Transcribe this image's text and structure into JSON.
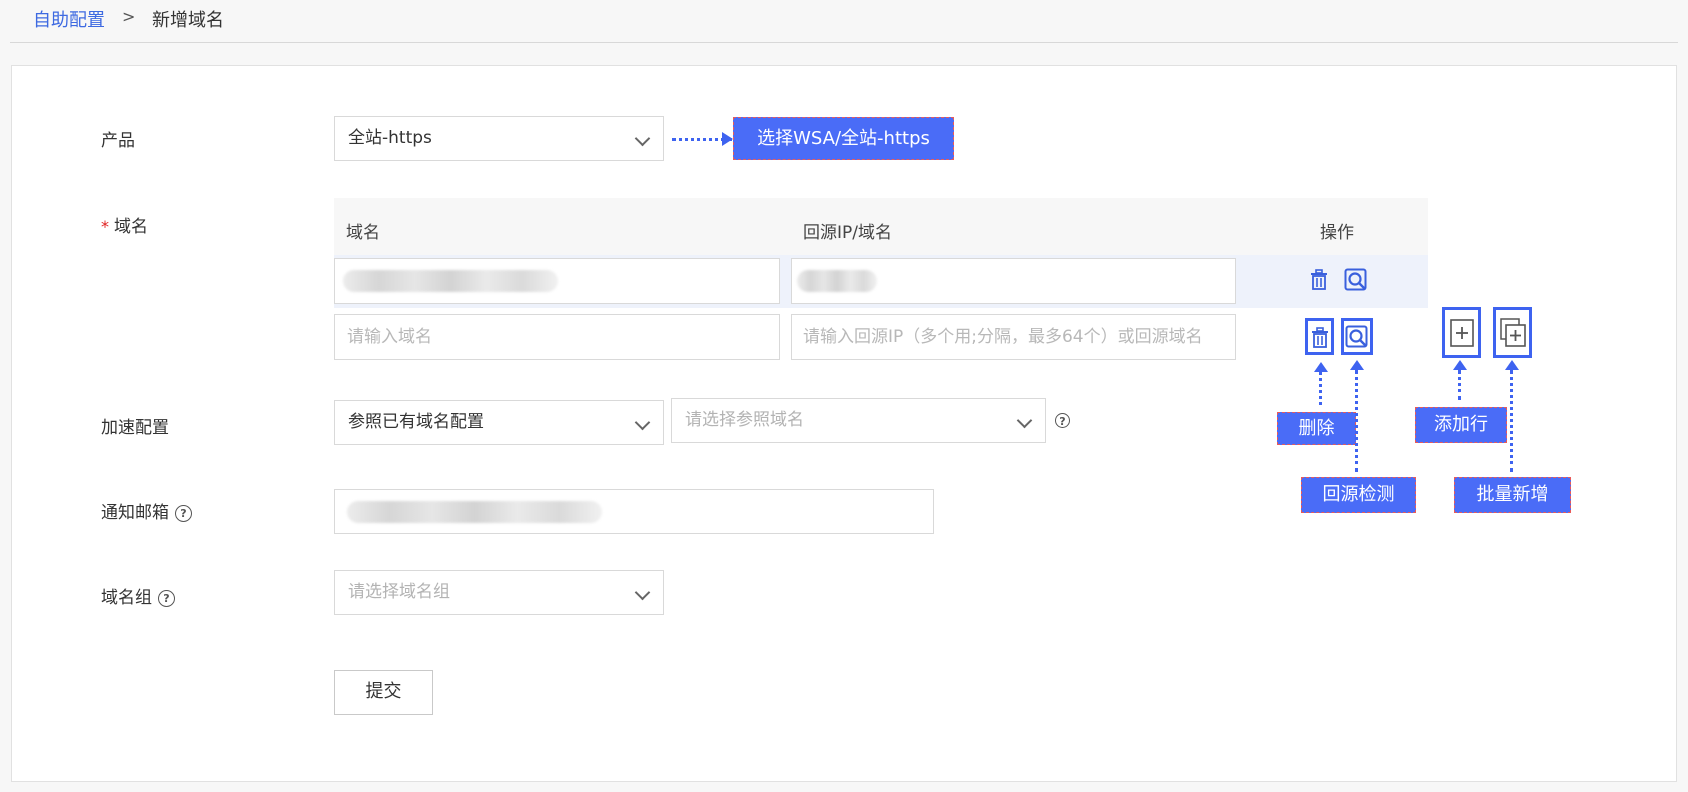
{
  "breadcrumb": {
    "parent": "自助配置",
    "separator": ">",
    "current": "新增域名"
  },
  "form": {
    "product": {
      "label": "产品",
      "value": "全站-https"
    },
    "domain": {
      "label": "域名",
      "columns": [
        "域名",
        "回源IP/域名",
        "操作"
      ],
      "row2": {
        "domain_placeholder": "请输入域名",
        "origin_placeholder": "请输入回源IP（多个用;分隔，最多64个）或回源域名"
      }
    },
    "accel": {
      "label": "加速配置",
      "mode_value": "参照已有域名配置",
      "ref_placeholder": "请选择参照域名"
    },
    "email": {
      "label": "通知邮箱"
    },
    "group": {
      "label": "域名组",
      "placeholder": "请选择域名组"
    },
    "submit_label": "提交"
  },
  "annotations": {
    "product_hint": "选择WSA/全站-https",
    "delete": "删除",
    "origin_check": "回源检测",
    "add_row": "添加行",
    "batch_add": "批量新增"
  },
  "icons": [
    "chevron-down-icon",
    "help-icon",
    "trash-icon",
    "origin-check-icon",
    "add-row-icon",
    "batch-add-icon"
  ],
  "colors": {
    "accent": "#3e6ae1",
    "annotation_bg": "#4a6cf7",
    "required": "#e02020"
  }
}
